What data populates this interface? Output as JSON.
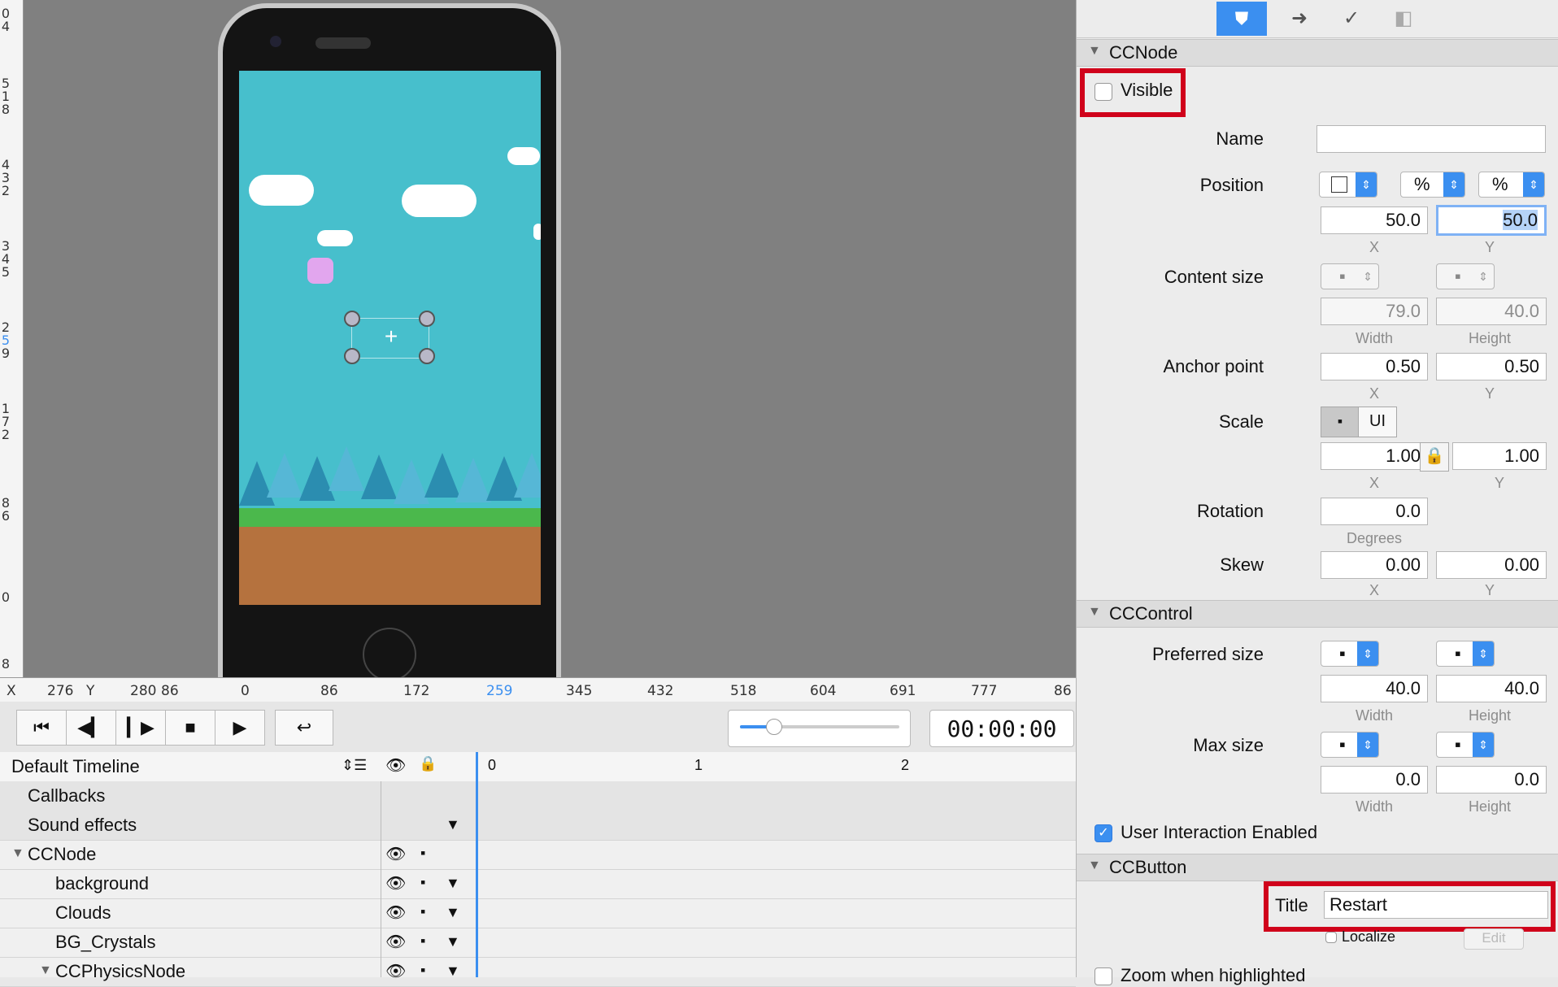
{
  "canvas": {
    "vruler_ticks": [
      "0",
      "4",
      "5",
      "1",
      "8",
      "4",
      "3",
      "2",
      "3",
      "4",
      "5",
      "2",
      "5",
      "9",
      "1",
      "7",
      "2",
      "8",
      "6",
      "0",
      "8"
    ],
    "hruler": {
      "x_label": "X",
      "x_value": "276",
      "y_label": "Y",
      "y_value": "280",
      "ticks": [
        "86",
        "0",
        "86",
        "172",
        "259",
        "345",
        "432",
        "518",
        "604",
        "691",
        "777",
        "86"
      ]
    }
  },
  "transport": {
    "buttons": [
      "rewind-start",
      "step-back",
      "step-forward",
      "stop",
      "play",
      "loop"
    ],
    "timecode": "00:00:00"
  },
  "timeline": {
    "header": {
      "name": "Default Timeline",
      "marks": [
        "0",
        "1",
        "2"
      ]
    },
    "rows": [
      {
        "label": "Callbacks",
        "indent": 0,
        "eye": false,
        "arrow": false
      },
      {
        "label": "Sound effects",
        "indent": 0,
        "eye": false,
        "arrow": true
      },
      {
        "label": "CCNode",
        "indent": 0,
        "eye": true,
        "arrow": false,
        "expanded": true
      },
      {
        "label": "background",
        "indent": 1,
        "eye": true,
        "arrow": true
      },
      {
        "label": "Clouds",
        "indent": 1,
        "eye": true,
        "arrow": true
      },
      {
        "label": "BG_Crystals",
        "indent": 1,
        "eye": true,
        "arrow": true
      },
      {
        "label": "CCPhysicsNode",
        "indent": 1,
        "eye": true,
        "arrow": true,
        "expanded": true
      }
    ]
  },
  "inspector": {
    "sections": {
      "node": "CCNode",
      "control": "CCControl",
      "button": "CCButton"
    },
    "visible_label": "Visible",
    "name_label": "Name",
    "name_value": "",
    "position": {
      "label": "Position",
      "unit_x": "%",
      "unit_y": "%",
      "x": "50.0",
      "y": "50.0",
      "x_sub": "X",
      "y_sub": "Y"
    },
    "content_size": {
      "label": "Content size",
      "w": "79.0",
      "h": "40.0",
      "w_sub": "Width",
      "h_sub": "Height"
    },
    "anchor": {
      "label": "Anchor point",
      "x": "0.50",
      "y": "0.50",
      "x_sub": "X",
      "y_sub": "Y"
    },
    "scale": {
      "label": "Scale",
      "ui": "UI",
      "x": "1.00",
      "y": "1.00",
      "x_sub": "X",
      "y_sub": "Y"
    },
    "rotation": {
      "label": "Rotation",
      "value": "0.0",
      "sub": "Degrees"
    },
    "skew": {
      "label": "Skew",
      "x": "0.00",
      "y": "0.00",
      "x_sub": "X",
      "y_sub": "Y"
    },
    "preferred": {
      "label": "Preferred size",
      "w": "40.0",
      "h": "40.0",
      "w_sub": "Width",
      "h_sub": "Height"
    },
    "max": {
      "label": "Max size",
      "w": "0.0",
      "h": "0.0",
      "w_sub": "Width",
      "h_sub": "Height"
    },
    "user_interaction": "User Interaction Enabled",
    "title_label": "Title",
    "title_value": "Restart",
    "localize": "Localize",
    "edit": "Edit",
    "zoom": "Zoom when highlighted",
    "accent": "#3b8ff0",
    "highlight": "#d0021b"
  }
}
